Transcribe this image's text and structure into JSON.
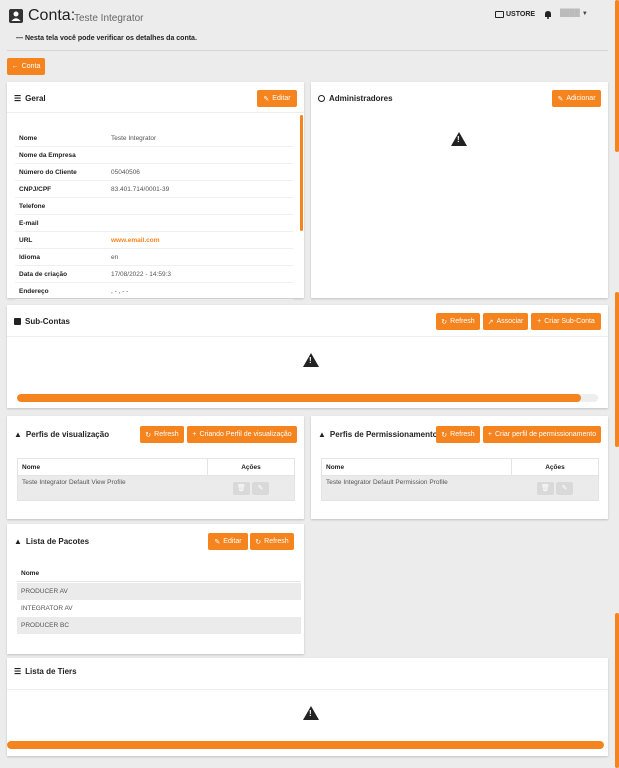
{
  "header": {
    "title": "Conta:",
    "account_name": "Teste Integrator",
    "store_label": "USTORE",
    "user_name": "████",
    "description": "—  Nesta tela você pode verificar os detalhes da conta."
  },
  "back_button": "Conta",
  "geral": {
    "title": "Geral",
    "edit_label": "Editar",
    "rows": [
      {
        "key": "Nome",
        "value": "Teste Integrator"
      },
      {
        "key": "Nome da Empresa",
        "value": ""
      },
      {
        "key": "Número do Cliente",
        "value": "05040506"
      },
      {
        "key": "CNPJ/CPF",
        "value": "83.401.714/0001-39"
      },
      {
        "key": "Telefone",
        "value": ""
      },
      {
        "key": "E-mail",
        "value": ""
      },
      {
        "key": "URL",
        "value": "www.email.com"
      },
      {
        "key": "Idioma",
        "value": "en"
      },
      {
        "key": "Data de criação",
        "value": "17/08/2022 - 14:59:3"
      },
      {
        "key": "Endereço",
        "value": ", - , - -"
      }
    ]
  },
  "admins": {
    "title": "Administradores",
    "add_label": "Adicionar"
  },
  "subcontas": {
    "title": "Sub-Contas",
    "refresh_label": "Refresh",
    "associate_label": "Associar",
    "create_label": "Criar Sub-Conta",
    "progress": 0.97
  },
  "view_profiles": {
    "title": "Perfis de visualização",
    "refresh_label": "Refresh",
    "create_label": "Criando Perfil de visualização",
    "col_name": "Nome",
    "col_actions": "Ações",
    "rows": [
      "Teste Integrator Default View Profile"
    ]
  },
  "perm_profiles": {
    "title": "Perfis de Permissionamento",
    "refresh_label": "Refresh",
    "create_label": "Criar perfil de permissionamento",
    "col_name": "Nome",
    "col_actions": "Ações",
    "rows": [
      "Teste Integrator Default Permission Profile"
    ]
  },
  "packages": {
    "title": "Lista de Pacotes",
    "edit_label": "Editar",
    "refresh_label": "Refresh",
    "col_name": "Nome",
    "rows": [
      "PRODUCER AV",
      "INTEGRATOR AV",
      "PRODUCER BC"
    ]
  },
  "tiers": {
    "title": "Lista de Tiers",
    "progress": 1.0
  },
  "colors": {
    "accent": "#f5841f",
    "background": "#ececec",
    "panel": "#ffffff",
    "row_stripe": "#ebebeb"
  }
}
